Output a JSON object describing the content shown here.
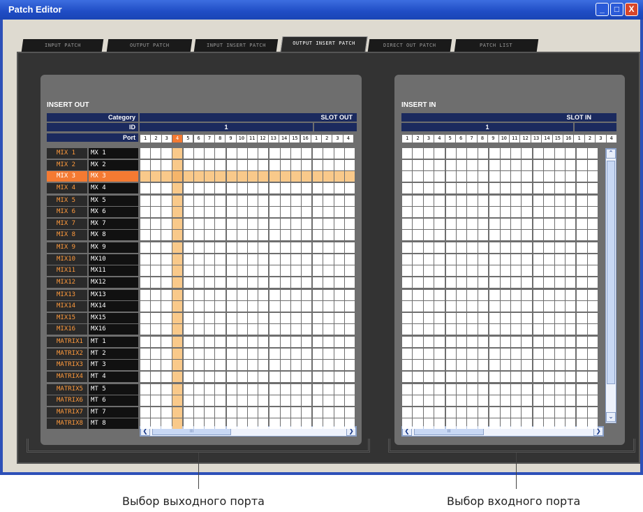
{
  "window": {
    "title": "Patch Editor",
    "min": "_",
    "max": "□",
    "close": "X"
  },
  "tabs": [
    {
      "label": "INPUT PATCH",
      "active": false
    },
    {
      "label": "OUTPUT PATCH",
      "active": false
    },
    {
      "label": "INPUT INSERT PATCH",
      "active": false
    },
    {
      "label": "OUTPUT INSERT PATCH",
      "active": true
    },
    {
      "label": "DIRECT OUT PATCH",
      "active": false
    },
    {
      "label": "PATCH LIST",
      "active": false
    }
  ],
  "insert_out": {
    "title": "INSERT OUT",
    "category_label": "Category",
    "id_label": "ID",
    "port_label": "Port",
    "slot_header": "SLOT OUT",
    "id_value": "1",
    "ports": [
      "1",
      "2",
      "3",
      "4",
      "5",
      "6",
      "7",
      "8",
      "9",
      "10",
      "11",
      "12",
      "13",
      "14",
      "15",
      "16",
      "1",
      "2",
      "3",
      "4"
    ],
    "selected_port_index": 3,
    "selected_row_index": 2,
    "rows": [
      {
        "ch": "MIX 1",
        "name": "MX 1"
      },
      {
        "ch": "MIX 2",
        "name": "MX 2"
      },
      {
        "ch": "MIX 3",
        "name": "MX 3"
      },
      {
        "ch": "MIX 4",
        "name": "MX 4"
      },
      {
        "ch": "MIX 5",
        "name": "MX 5"
      },
      {
        "ch": "MIX 6",
        "name": "MX 6"
      },
      {
        "ch": "MIX 7",
        "name": "MX 7"
      },
      {
        "ch": "MIX 8",
        "name": "MX 8"
      },
      {
        "ch": "MIX 9",
        "name": "MX 9"
      },
      {
        "ch": "MIX10",
        "name": "MX10"
      },
      {
        "ch": "MIX11",
        "name": "MX11"
      },
      {
        "ch": "MIX12",
        "name": "MX12"
      },
      {
        "ch": "MIX13",
        "name": "MX13"
      },
      {
        "ch": "MIX14",
        "name": "MX14"
      },
      {
        "ch": "MIX15",
        "name": "MX15"
      },
      {
        "ch": "MIX16",
        "name": "MX16"
      },
      {
        "ch": "MATRIX1",
        "name": "MT 1"
      },
      {
        "ch": "MATRIX2",
        "name": "MT 2"
      },
      {
        "ch": "MATRIX3",
        "name": "MT 3"
      },
      {
        "ch": "MATRIX4",
        "name": "MT 4"
      },
      {
        "ch": "MATRIX5",
        "name": "MT 5"
      },
      {
        "ch": "MATRIX6",
        "name": "MT 6"
      },
      {
        "ch": "MATRIX7",
        "name": "MT 7"
      },
      {
        "ch": "MATRIX8",
        "name": "MT 8"
      }
    ],
    "scroll_thumb_label": "III"
  },
  "insert_in": {
    "title": "INSERT IN",
    "slot_header": "SLOT IN",
    "id_value": "1",
    "ports": [
      "1",
      "2",
      "3",
      "4",
      "5",
      "6",
      "7",
      "8",
      "9",
      "10",
      "11",
      "12",
      "13",
      "14",
      "15",
      "16",
      "1",
      "2",
      "3",
      "4"
    ],
    "scroll_thumb_label": "III"
  },
  "captions": {
    "output": "Выбор выходного порта",
    "input": "Выбор входного порта"
  },
  "colors": {
    "accent": "#f47a32",
    "highlight": "#f9c98a",
    "label_orange": "#ff9a3c"
  }
}
